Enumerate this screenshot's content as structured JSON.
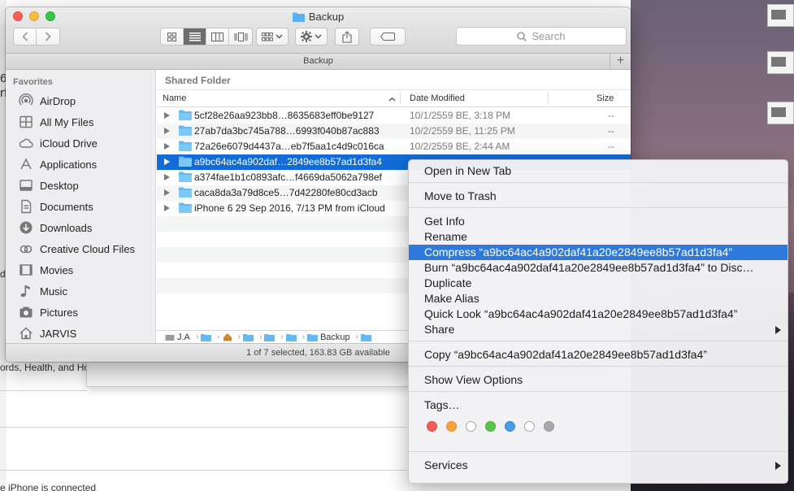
{
  "window": {
    "title": "Backup",
    "path_title": "Backup",
    "search_placeholder": "Search",
    "status": "1 of 7 selected, 163.83 GB available"
  },
  "sidebar": {
    "header": "Favorites",
    "items": [
      {
        "label": "AirDrop",
        "icon": "airdrop-icon"
      },
      {
        "label": "All My Files",
        "icon": "all-files-icon"
      },
      {
        "label": "iCloud Drive",
        "icon": "cloud-icon"
      },
      {
        "label": "Applications",
        "icon": "applications-icon"
      },
      {
        "label": "Desktop",
        "icon": "desktop-icon"
      },
      {
        "label": "Documents",
        "icon": "documents-icon"
      },
      {
        "label": "Downloads",
        "icon": "downloads-icon"
      },
      {
        "label": "Creative Cloud Files",
        "icon": "creative-cloud-icon"
      },
      {
        "label": "Movies",
        "icon": "movies-icon"
      },
      {
        "label": "Music",
        "icon": "music-icon"
      },
      {
        "label": "Pictures",
        "icon": "pictures-icon"
      },
      {
        "label": "JARVIS",
        "icon": "home-icon"
      }
    ]
  },
  "content": {
    "section_label": "Shared Folder",
    "columns": {
      "name": "Name",
      "date": "Date Modified",
      "size": "Size"
    },
    "rows": [
      {
        "name": "5cf28e26aa923bb8…8635683eff0be9127",
        "date": "10/1/2559 BE, 3:18 PM",
        "size": "--"
      },
      {
        "name": "27ab7da3bc745a788…6993f040b87ac883",
        "date": "10/2/2559 BE, 11:25 PM",
        "size": "--"
      },
      {
        "name": "72a26e6079d4437a…eb7f5aa1c4d9c016ca",
        "date": "10/2/2559 BE, 2:44 AM",
        "size": "--"
      },
      {
        "name": "a9bc64ac4a902daf…2849ee8b57ad1d3fa4",
        "date": "",
        "size": ""
      },
      {
        "name": "a374fae1b1c0893afc…f4669da5062a798ef",
        "date": "",
        "size": ""
      },
      {
        "name": "caca8da3a79d8ce5…7d42280fe80cd3acb",
        "date": "",
        "size": ""
      },
      {
        "name": "iPhone 6 29 Sep 2016, 7/13 PM from iCloud",
        "date": "",
        "size": ""
      }
    ],
    "breadcrumb": [
      "J.A",
      "Backup"
    ]
  },
  "context_menu": {
    "items": [
      "Open in New Tab",
      "Move to Trash",
      "Get Info",
      "Rename",
      "Compress “a9bc64ac4a902daf41a20e2849ee8b57ad1d3fa4”",
      "Burn “a9bc64ac4a902daf41a20e2849ee8b57ad1d3fa4” to Disc…",
      "Duplicate",
      "Make Alias",
      "Quick Look “a9bc64ac4a902daf41a20e2849ee8b57ad1d3fa4”",
      "Share",
      "Copy “a9bc64ac4a902daf41a20e2849ee8b57ad1d3fa4”",
      "Show View Options",
      "Tags…",
      "Services"
    ],
    "tag_colors": [
      "#f25c54",
      "#f7a13a",
      "#ffffff",
      "#5cc34e",
      "#4a9ce8",
      "#ffffff",
      "#a9a9a9"
    ]
  },
  "background_text": [
    "6",
    "rf",
    "d",
    "ords, Health, and Ho",
    "e iPhone is connected"
  ]
}
